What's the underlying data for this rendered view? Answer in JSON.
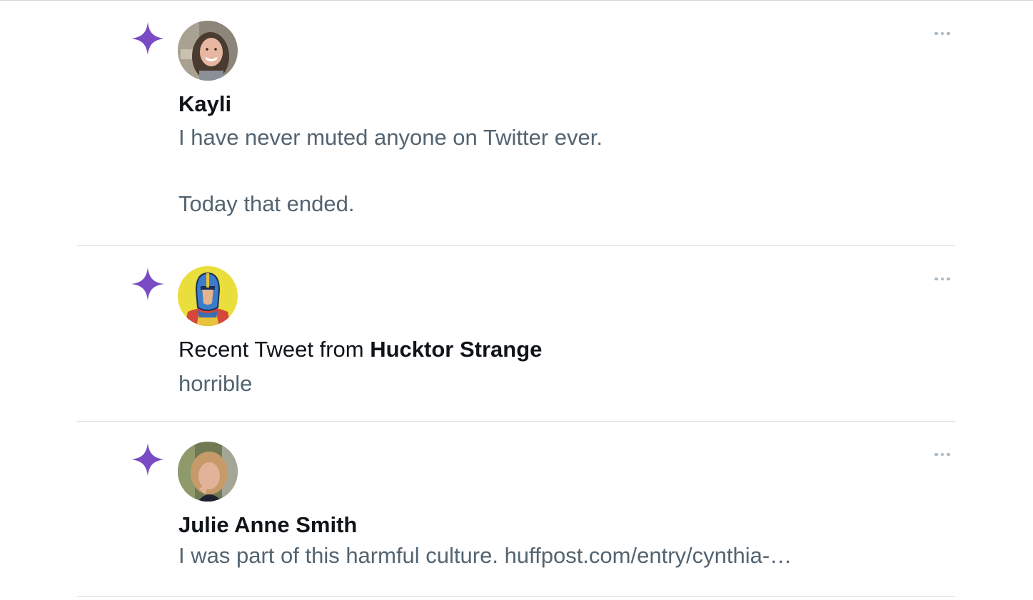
{
  "accent_color": "#794bc4",
  "notifications": [
    {
      "icon": "sparkle-icon",
      "avatar": "avatar-kayli",
      "name": "Kayli",
      "text_lines": [
        "I have never muted anyone on Twitter ever.",
        "Today that ended."
      ],
      "more_icon": "more-options-icon"
    },
    {
      "icon": "sparkle-icon",
      "avatar": "avatar-hucktor-strange",
      "prefix": "Recent Tweet from ",
      "name": "Hucktor Strange",
      "text_lines": [
        "horrible"
      ],
      "more_icon": "more-options-icon"
    },
    {
      "icon": "sparkle-icon",
      "avatar": "avatar-julie-anne-smith",
      "name": "Julie Anne Smith",
      "text_lines": [
        "I was part of this harmful culture.  huffpost.com/entry/cynthia-…"
      ],
      "more_icon": "more-options-icon"
    }
  ]
}
